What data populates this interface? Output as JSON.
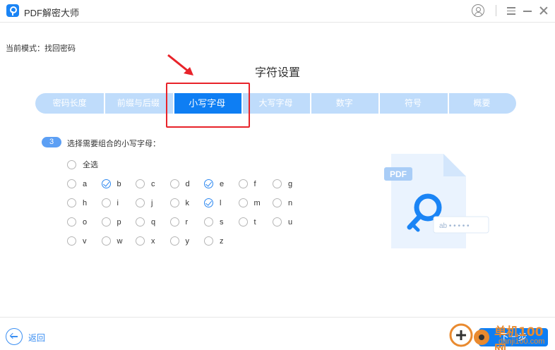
{
  "app": {
    "title": "PDF解密大师"
  },
  "mode_text": "当前模式：找回密码",
  "page_title": "字符设置",
  "steps": [
    {
      "label": "密码长度"
    },
    {
      "label": "前缀与后缀"
    },
    {
      "label": "小写字母",
      "active": true
    },
    {
      "label": "大写字母"
    },
    {
      "label": "数字"
    },
    {
      "label": "符号"
    },
    {
      "label": "概要"
    }
  ],
  "question": {
    "number": "3",
    "text": "选择需要组合的小写字母："
  },
  "select_all": {
    "label": "全选",
    "checked": false
  },
  "letters": [
    {
      "label": "a",
      "checked": false
    },
    {
      "label": "b",
      "checked": true
    },
    {
      "label": "c",
      "checked": false
    },
    {
      "label": "d",
      "checked": false
    },
    {
      "label": "e",
      "checked": true
    },
    {
      "label": "f",
      "checked": false
    },
    {
      "label": "g",
      "checked": false
    },
    {
      "label": "h",
      "checked": false
    },
    {
      "label": "i",
      "checked": false
    },
    {
      "label": "j",
      "checked": false
    },
    {
      "label": "k",
      "checked": false
    },
    {
      "label": "l",
      "checked": true
    },
    {
      "label": "m",
      "checked": false
    },
    {
      "label": "n",
      "checked": false
    },
    {
      "label": "o",
      "checked": false
    },
    {
      "label": "p",
      "checked": false
    },
    {
      "label": "q",
      "checked": false
    },
    {
      "label": "r",
      "checked": false
    },
    {
      "label": "s",
      "checked": false
    },
    {
      "label": "t",
      "checked": false
    },
    {
      "label": "u",
      "checked": false
    },
    {
      "label": "v",
      "checked": false
    },
    {
      "label": "w",
      "checked": false
    },
    {
      "label": "x",
      "checked": false
    },
    {
      "label": "y",
      "checked": false
    },
    {
      "label": "z",
      "checked": false
    }
  ],
  "illustration": {
    "badge": "PDF",
    "password_mask": "ab • • • • •"
  },
  "footer": {
    "back_label": "返回",
    "next_label": "下一步"
  },
  "watermark": {
    "text": "单机100网",
    "url": "danji100.com"
  },
  "colors": {
    "accent": "#0e7ef3",
    "tab_bg": "#bfdcfb",
    "highlight": "#e8232a"
  },
  "icons": {
    "app": "pdf-key-icon",
    "user": "user-icon",
    "menu": "menu-icon",
    "minimize": "minimize-icon",
    "close": "close-icon",
    "back": "back-arrow-icon"
  }
}
